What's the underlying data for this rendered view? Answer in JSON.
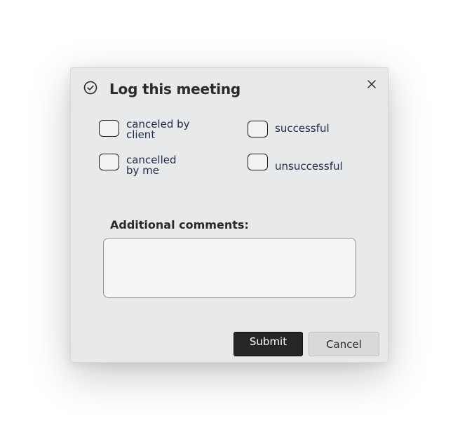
{
  "dialog": {
    "title": "Log this meeting",
    "header_icon": "check-circle-icon",
    "close_icon": "close-icon"
  },
  "options": [
    {
      "label": "canceled by\nclient",
      "checked": false
    },
    {
      "label": "successful",
      "checked": false
    },
    {
      "label": "cancelled\nby me",
      "checked": false
    },
    {
      "label": "unsuccessful",
      "checked": false
    }
  ],
  "comments": {
    "label": "Additional comments:",
    "value": ""
  },
  "actions": {
    "submit_label": "Submit",
    "cancel_label": "Cancel"
  },
  "colors": {
    "dialog_bg": "#e8e9eb",
    "option_text": "#1f2a48",
    "submit_bg": "#262626",
    "cancel_bg": "#d8d9db"
  }
}
